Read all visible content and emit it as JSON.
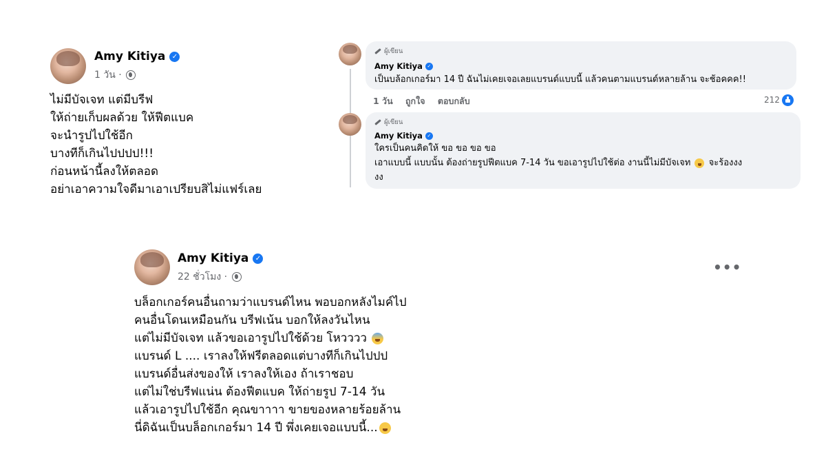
{
  "post1": {
    "author": "Amy Kitiya",
    "time": "1 วัน ·",
    "lines": [
      "ไม่มีบัจเจท แต่มีบรีฟ",
      "ให้ถ่ายเก็บผลด้วย ให้ฟีตแบค",
      "จะนำรูปไปใช้อีก",
      "บางทีก็เกินไปปปป!!!",
      "ก่อนหน้านี้ลงให้ตลอด",
      "อย่าเอาความใจดีมาเอาเปรียบสิไม่แฟร์เลย"
    ]
  },
  "comment1": {
    "badge": "ผู้เขียน",
    "author": "Amy Kitiya",
    "text": "เป็นบล้อกเกอร์มา 14 ปี ฉันไม่เคยเจอเลยแบรนด์แบบนี้ แล้วคนตามแบรนด์หลายล้าน จะช้อคคค!!",
    "time": "1 วัน",
    "like": "ถูกใจ",
    "reply": "ตอบกลับ",
    "reactions": "212"
  },
  "comment2": {
    "badge": "ผู้เขียน",
    "author": "Amy Kitiya",
    "line1": "ใครเป็นคนคิดให้ ขอ ขอ ขอ ขอ",
    "line2a": "เอาแบบนี้ แบบนั้น ต้องถ่ายรูปฟีตแบค 7-14 วัน ขอเอารูปไปใช้ต่อ งานนี้ไม่มีบัจเจท",
    "line2b": "จะร้องงง",
    "line3": "งง"
  },
  "post2": {
    "author": "Amy Kitiya",
    "time": "22 ชั่วโมง ·",
    "line1": "บล็อกเกอร์คนอื่นถามว่าแบรนด์ไหน พอบอกหลังไมค์ไป",
    "line2": "คนอื่นโดนเหมือนกัน บรีฟเน้น บอกให้ลงวันไหน",
    "line3": "แต่ไม่มีบัจเจท แล้วขอเอารูปไปใช้ด้วย โหวววว",
    "line4": "แบรนด์ L  ....  เราลงให้ฟรีตลอดแต่บางทีก็เกินไปปป",
    "line5": "แบรนด์อื่นส่งของให้ เราลงให้เอง ถ้าเราชอบ",
    "line6": "แต่ไม่ใช่บรีฟแน่น ต้องฟีตแบค ให้ถ่ายรูป 7-14 วัน",
    "line7": "แล้วเอารูปไปใช้อีก คุณขาาาา ขายของหลายร้อยล้าน",
    "line8": "นี่ดิฉันเป็นบล็อกเกอร์มา 14 ปี พึ่งเคยเจอแบบนี้..."
  },
  "icons": {
    "verified": "verified-badge-icon",
    "globe": "globe-icon",
    "pencil": "pencil-icon",
    "like": "like-icon",
    "more": "more-options-icon",
    "emoji_laugh": "laughing-emoji",
    "emoji_fear": "anxious-emoji",
    "emoji_grimace": "grimacing-emoji"
  },
  "colors": {
    "accent": "#1877f2",
    "bubble": "#f0f2f5",
    "meta": "#65676b"
  }
}
